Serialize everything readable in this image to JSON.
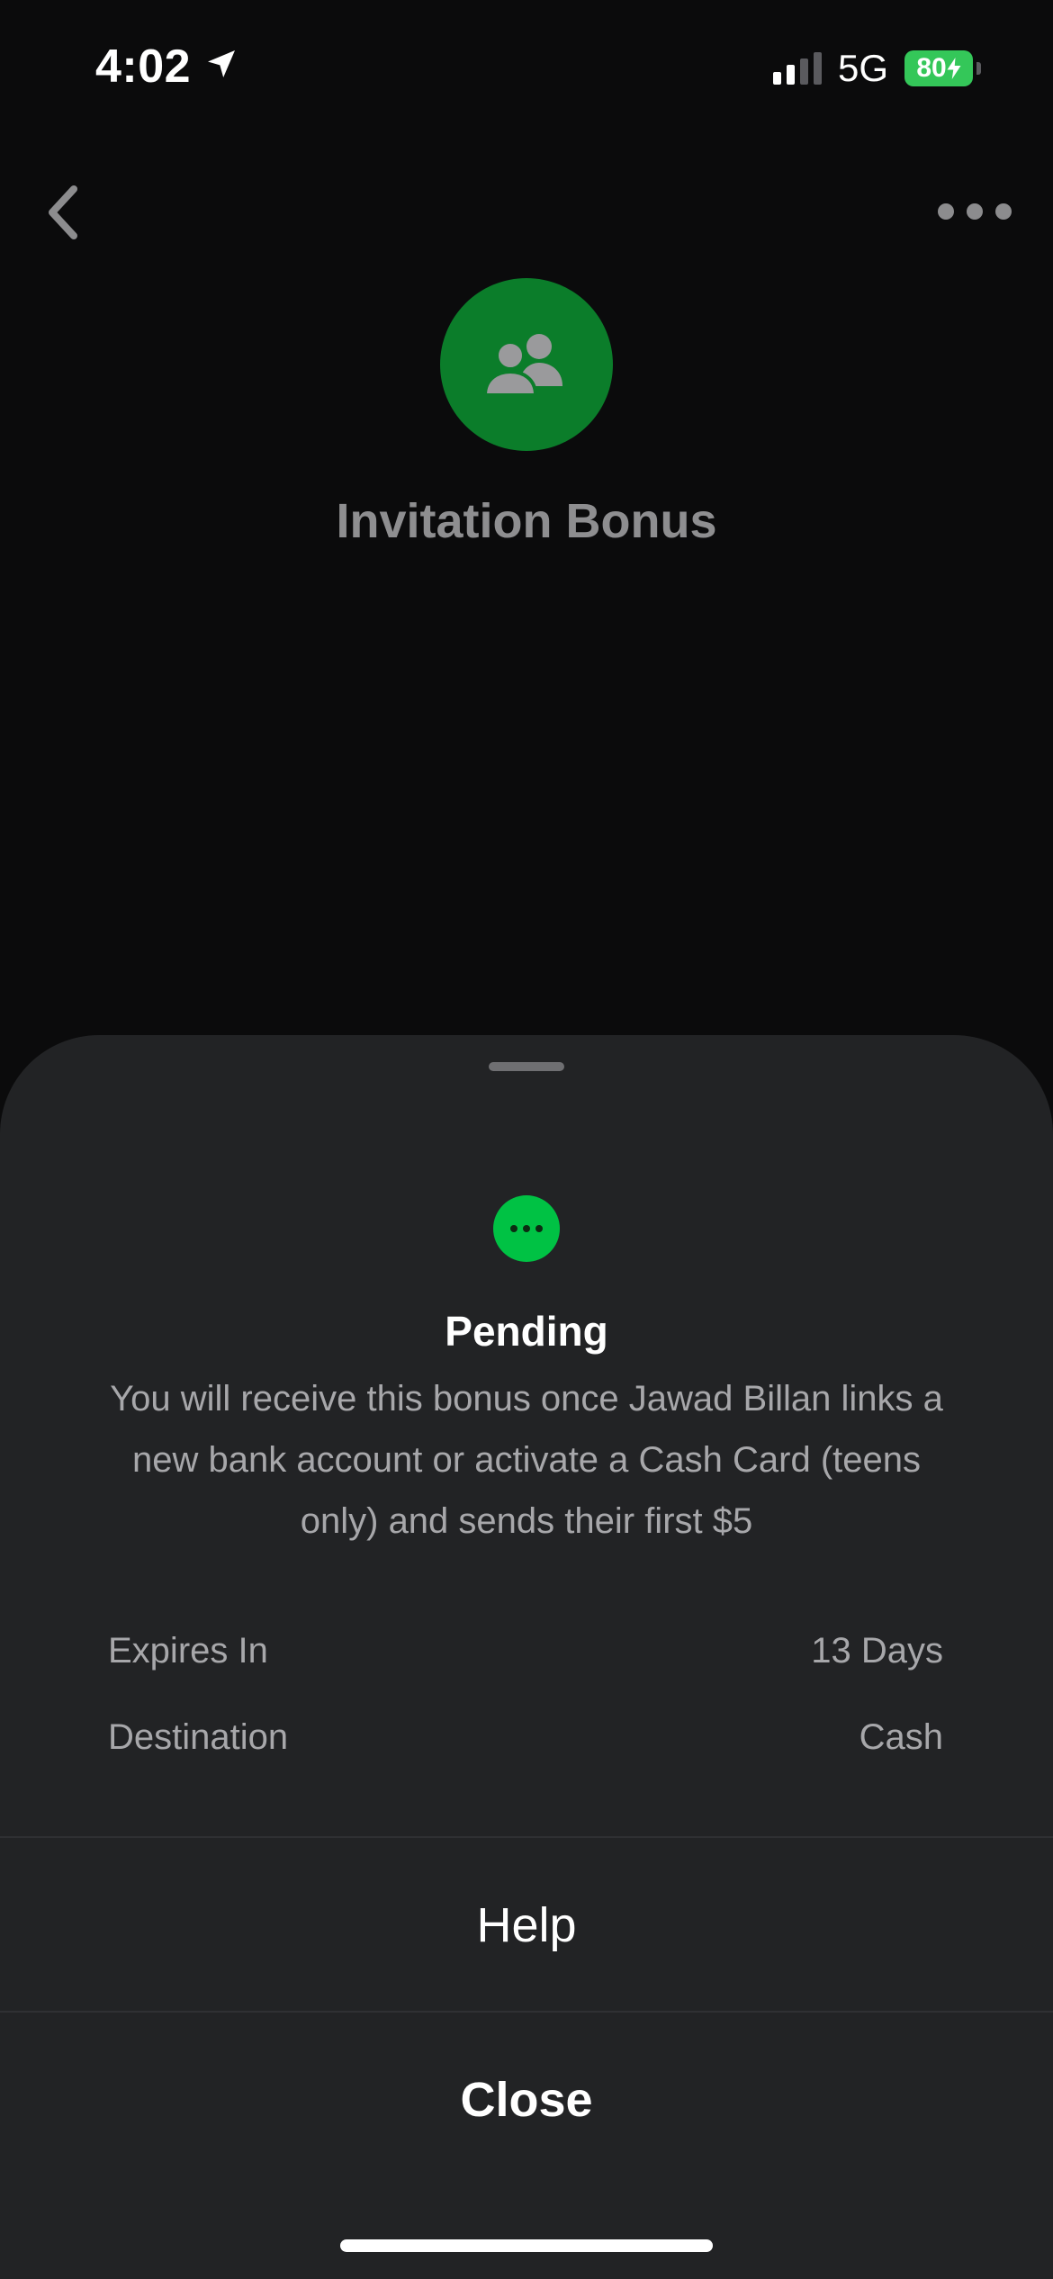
{
  "status_bar": {
    "time": "4:02",
    "network": "5G",
    "battery": "80"
  },
  "header": {
    "title": "Invitation Bonus"
  },
  "sheet": {
    "status_title": "Pending",
    "status_description": "You will receive this bonus once Jawad Billan links a new bank account or activate a Cash Card (teens only) and sends their first $5",
    "details": [
      {
        "label": "Expires In",
        "value": "13 Days"
      },
      {
        "label": "Destination",
        "value": "Cash"
      }
    ],
    "help_label": "Help",
    "close_label": "Close"
  },
  "colors": {
    "background": "#0b0b0c",
    "sheet": "#222325",
    "avatar_green": "#0b7d2a",
    "pending_green": "#00c244",
    "battery_green": "#34c759"
  },
  "icons": {
    "back": "chevron-left-icon",
    "more": "more-horizontal-icon",
    "avatar": "people-icon",
    "status": "pending-dots-icon",
    "location": "location-arrow-icon"
  }
}
